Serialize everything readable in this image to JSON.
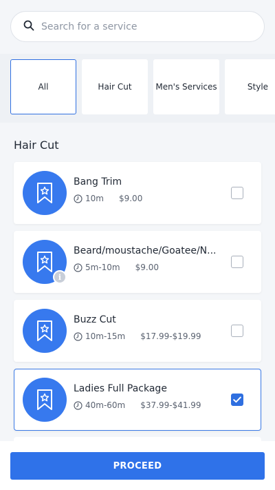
{
  "search": {
    "placeholder": "Search for a service",
    "icon": "search-icon"
  },
  "tabs": [
    {
      "label": "All",
      "active": true
    },
    {
      "label": "Hair Cut",
      "active": false
    },
    {
      "label": "Men's Services",
      "active": false
    },
    {
      "label": "Style",
      "active": false
    }
  ],
  "section": {
    "title": "Hair Cut"
  },
  "services": [
    {
      "name": "Bang Trim",
      "duration": "10m",
      "price": "$9.00",
      "selected": false,
      "info": false
    },
    {
      "name": "Beard/moustache/Goatee/N...",
      "duration": "5m-10m",
      "price": "$9.00",
      "selected": false,
      "info": true
    },
    {
      "name": "Buzz Cut",
      "duration": "10m-15m",
      "price": "$17.99-$19.99",
      "selected": false,
      "info": false
    },
    {
      "name": "Ladies Full Package",
      "duration": "40m-60m",
      "price": "$37.99-$41.99",
      "selected": true,
      "info": false
    }
  ],
  "info_badge": "i",
  "footer": {
    "proceed_label": "PROCEED"
  },
  "colors": {
    "accent": "#2f72e9",
    "avatar": "#3779ee",
    "background": "#f4f6f9"
  }
}
